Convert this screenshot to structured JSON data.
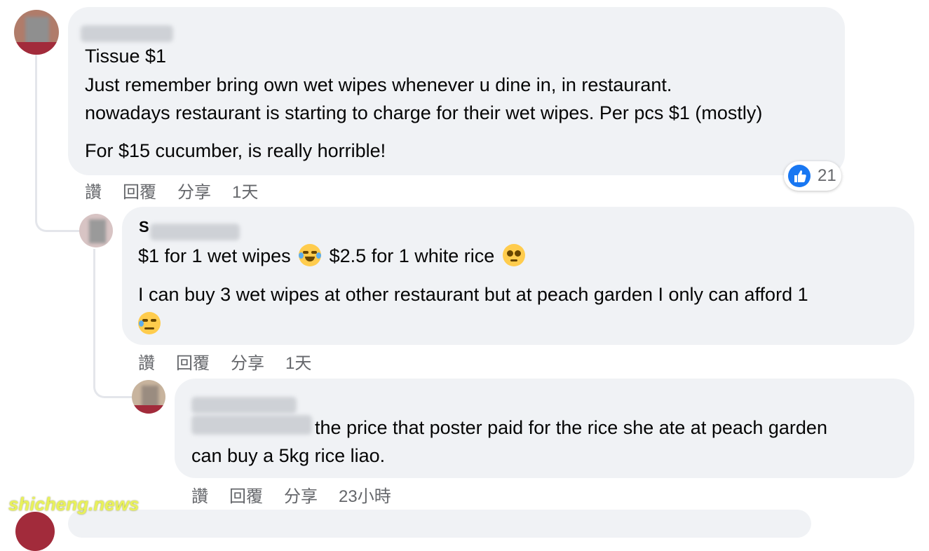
{
  "comments": [
    {
      "lines": [
        "Tissue $1",
        "Just remember bring own wet wipes whenever u dine in, in restaurant.",
        "nowadays restaurant is starting to charge for their wet wipes. Per pcs $1 (mostly)",
        "For $15 cucumber, is really horrible!"
      ],
      "actions": {
        "like": "讚",
        "reply": "回覆",
        "share": "分享",
        "time": "1天"
      },
      "reactions": {
        "icon": "like-icon",
        "count": "21",
        "color": "#1877f2"
      }
    },
    {
      "name_initial": "S",
      "line1_a": "$1 for 1 wet wipes",
      "line1_b": "$2.5 for 1 white rice",
      "line2": "I can buy 3 wet wipes at other restaurant but at peach garden I only can afford 1",
      "emojis": [
        "face-with-tears-of-joy-icon",
        "pleading-face-icon",
        "sad-but-relieved-face-icon"
      ],
      "actions": {
        "like": "讚",
        "reply": "回覆",
        "share": "分享",
        "time": "1天"
      }
    },
    {
      "line1": "the price that poster paid for the rice she ate at peach garden",
      "line2": "can buy a 5kg rice liao.",
      "actions": {
        "like": "讚",
        "reply": "回覆",
        "share": "分享",
        "time": "23小時"
      }
    }
  ],
  "watermark": "shicheng.news",
  "colors": {
    "bubble": "#f0f2f5",
    "meta_text": "#65676b",
    "link_blue": "#1877f2"
  }
}
